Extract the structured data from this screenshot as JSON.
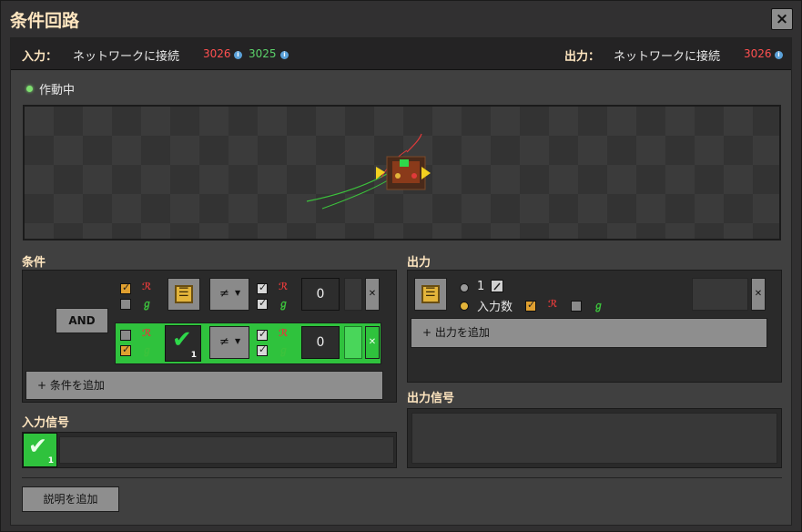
{
  "window": {
    "title": "条件回路",
    "close_label": "×"
  },
  "input_bar": {
    "label": "入力：",
    "network": "ネットワークに接続",
    "red_id": "3026",
    "green_id": "3025"
  },
  "output_bar": {
    "label": "出力：",
    "network": "ネットワークに接続",
    "red_id": "3026"
  },
  "info_glyph": "i",
  "status": {
    "text": "作動中",
    "color": "#7fe070"
  },
  "conditions": {
    "title": "条件",
    "combinator_label": "AND",
    "rows": [
      {
        "red_checked": true,
        "green_checked": false,
        "signal_icon": "chip-icon",
        "operator": "≠",
        "value": "0",
        "active": false
      },
      {
        "red_checked": false,
        "green_checked": true,
        "signal_icon": "checkmark-icon",
        "signal_count": "1",
        "operator": "≠",
        "value": "0",
        "active": true
      }
    ],
    "add_button": "+ 条件を追加"
  },
  "input_signals": {
    "title": "入力信号",
    "signal_icon": "checkmark-icon",
    "count": "1"
  },
  "outputs": {
    "title": "出力",
    "signal_icon": "chip-icon",
    "option_one": "1",
    "option_input_count": "入力数",
    "selected": "入力数",
    "add_button": "+ 出力を追加"
  },
  "output_signals": {
    "title": "出力信号"
  },
  "footer": {
    "add_description": "説明を追加"
  },
  "wire_labels": {
    "red": "ℛ",
    "green": "ℊ"
  },
  "dropdown_arrow": "▼",
  "colors": {
    "red_wire": "#e03a3a",
    "green_wire": "#3cc23c",
    "active_row": "#2fc23d",
    "title": "#ffe6c0"
  }
}
